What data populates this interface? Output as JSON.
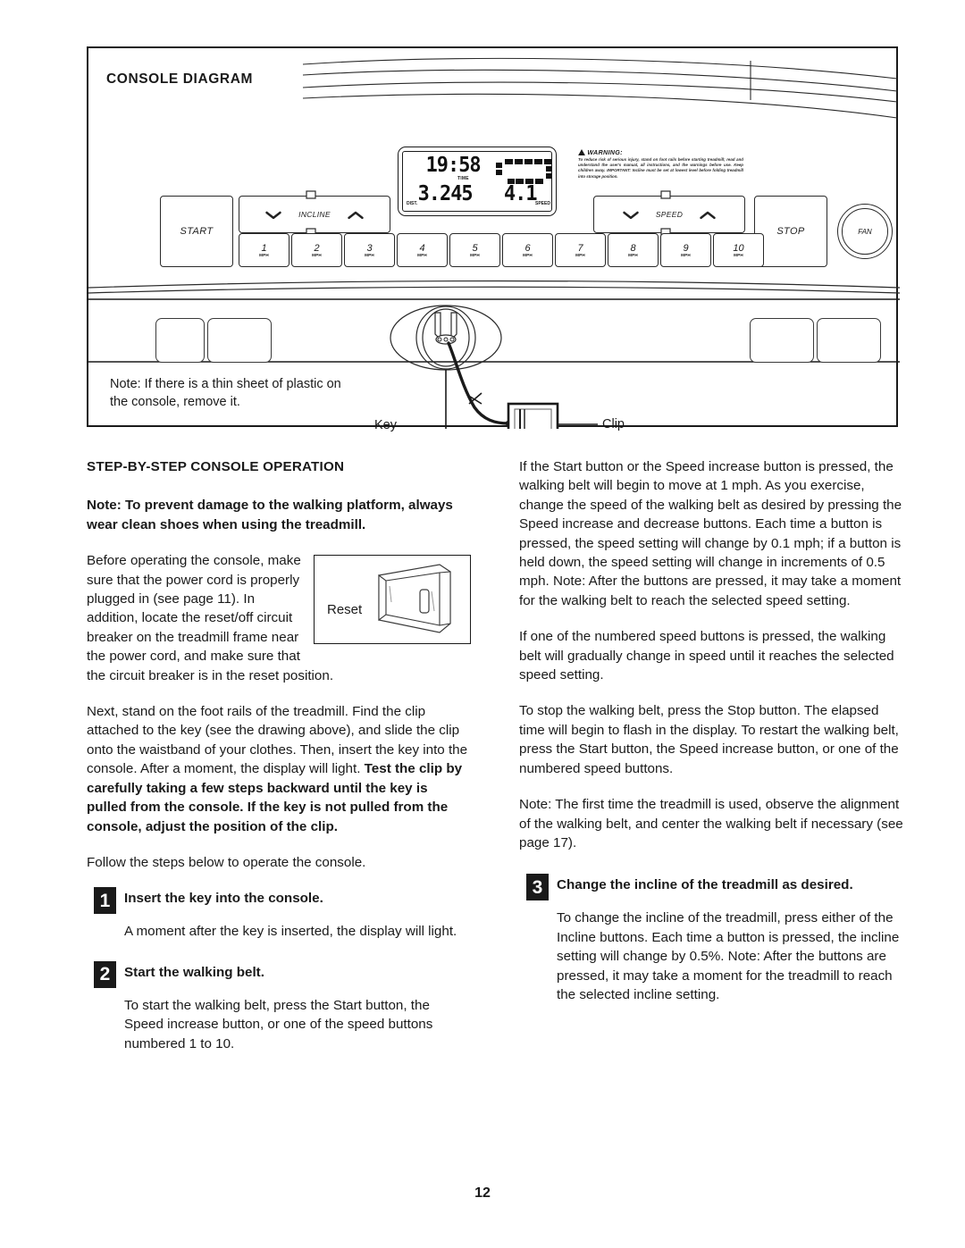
{
  "page": {
    "number": "12"
  },
  "console_diagram": {
    "title": "CONSOLE DIAGRAM",
    "display": {
      "time_value": "19:58",
      "time_label": "TIME",
      "dist_label": "DIST.",
      "dist_value": "3.245",
      "speed_value": "4.1",
      "speed_label": "SPEED"
    },
    "warning": {
      "icon": "warning-triangle-icon",
      "heading": "WARNING:",
      "body": "To reduce risk of serious injury, stand on foot rails before starting treadmill; read and understand the user's manual, all instructions, and the warnings before use.  Keep children away.  IMPORTANT: Incline must be set at lowest level before folding treadmill into storage position."
    },
    "buttons": {
      "start": "START",
      "stop": "STOP",
      "fan": "FAN",
      "incline": "INCLINE",
      "speed": "SPEED"
    },
    "speed_buttons": [
      {
        "number": "1",
        "unit": "MPH"
      },
      {
        "number": "2",
        "unit": "MPH"
      },
      {
        "number": "3",
        "unit": "MPH"
      },
      {
        "number": "4",
        "unit": "MPH"
      },
      {
        "number": "5",
        "unit": "MPH"
      },
      {
        "number": "6",
        "unit": "MPH"
      },
      {
        "number": "7",
        "unit": "MPH"
      },
      {
        "number": "8",
        "unit": "MPH"
      },
      {
        "number": "9",
        "unit": "MPH"
      },
      {
        "number": "10",
        "unit": "MPH"
      }
    ],
    "callouts": {
      "key": "Key",
      "clip": "Clip"
    },
    "note": "Note: If there is a thin sheet of plastic on the console, remove it."
  },
  "left_column": {
    "section_heading": "STEP-BY-STEP CONSOLE OPERATION",
    "note_bold": "Note: To prevent damage to the walking platform, always wear clean shoes when using the treadmill.",
    "para_before_operating": "Before operating the console, make sure that the power cord is properly plugged in (see page 11). In addition, locate the reset/off circuit breaker on the treadmill frame near the power cord, and make sure that the circuit breaker is in the reset position.",
    "reset_figure_label": "Reset",
    "para_next_normal_1": "Next, stand on the foot rails of the treadmill. Find the clip attached to the key (see the drawing above), and slide the clip onto the waistband of your clothes. Then, insert the key into the console. After a moment, the display will light. ",
    "para_next_bold": "Test the clip by carefully taking a few steps backward until the key is pulled from the console. If the key is not pulled from the console, adjust the position of the clip.",
    "para_follow_steps": "Follow the steps below to operate the console.",
    "steps": [
      {
        "number": "1",
        "title": "Insert the key into the console.",
        "body": "A moment after the key is inserted, the display will light."
      },
      {
        "number": "2",
        "title": "Start the walking belt.",
        "body": "To start the walking belt, press the Start button, the Speed increase button, or one of the speed buttons numbered 1 to 10."
      }
    ]
  },
  "right_column": {
    "para_start_speed": "If the Start button or the Speed increase button is pressed, the walking belt will begin to move at 1 mph. As you exercise, change the speed of the walking belt as desired by pressing the Speed increase and decrease buttons. Each time a button is pressed, the speed setting will change by 0.1 mph; if a button is held down, the speed setting will change in increments of 0.5 mph. Note: After the buttons are pressed, it may take a moment for the walking belt to reach the selected speed setting.",
    "para_numbered": "If one of the numbered speed buttons is pressed, the walking belt will gradually change in speed until it reaches the selected speed setting.",
    "para_stop": "To stop the walking belt, press the Stop button. The elapsed time will begin to flash in the display. To restart the walking belt, press the Start button, the Speed increase button, or one of the numbered speed buttons.",
    "para_note_alignment": "Note: The first time the treadmill is used, observe the alignment of the walking belt, and center the walking belt if necessary (see page 17).",
    "steps": [
      {
        "number": "3",
        "title": "Change the incline of the treadmill as desired.",
        "body": "To change the incline of the treadmill, press either of the Incline buttons. Each time a button is pressed, the incline setting will change by 0.5%. Note: After the buttons are pressed, it may take a moment for the treadmill to reach the selected incline setting."
      }
    ]
  }
}
